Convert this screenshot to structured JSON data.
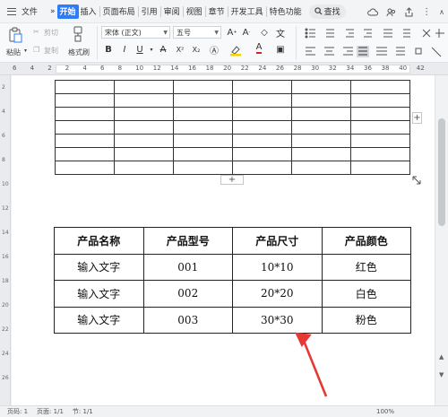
{
  "menubar": {
    "file": "文件",
    "tabs": [
      "开始",
      "插入",
      "页面布局",
      "引用",
      "审阅",
      "视图",
      "章节",
      "开发工具",
      "特色功能"
    ],
    "search": "查找"
  },
  "ribbon": {
    "paste": "粘贴",
    "cut": "剪切",
    "copy": "复制",
    "format_painter": "格式刷",
    "font": "宋体 (正文)",
    "size": "五号",
    "bold": "B",
    "italic": "I",
    "underline": "U",
    "strikethrough": "A",
    "superscript": "X²",
    "subscript": "X₂",
    "font_color": "A"
  },
  "ruler": {
    "numbers": [
      "6",
      "4",
      "2",
      "2",
      "4",
      "6",
      "8",
      "10",
      "12",
      "14",
      "16",
      "18",
      "20",
      "22",
      "24",
      "26",
      "28",
      "30",
      "32",
      "34",
      "36",
      "38",
      "40",
      "42"
    ]
  },
  "vruler": {
    "numbers": [
      "2",
      "4",
      "6",
      "8",
      "10",
      "12",
      "14",
      "16",
      "18",
      "20",
      "22",
      "24",
      "26"
    ]
  },
  "table": {
    "headers": [
      "产品名称",
      "产品型号",
      "产品尺寸",
      "产品颜色"
    ],
    "rows": [
      [
        "输入文字",
        "001",
        "10*10",
        "红色"
      ],
      [
        "输入文字",
        "002",
        "20*20",
        "白色"
      ],
      [
        "输入文字",
        "003",
        "30*30",
        "粉色"
      ]
    ]
  },
  "handles": {
    "add_col": "+",
    "add_row": "+"
  },
  "statusbar": {
    "page": "页码: 1",
    "pages": "页面: 1/1",
    "section": "节: 1/1",
    "zoom": "100%"
  },
  "colors": {
    "accent": "#2f7df6",
    "arrow": "#e53935"
  }
}
